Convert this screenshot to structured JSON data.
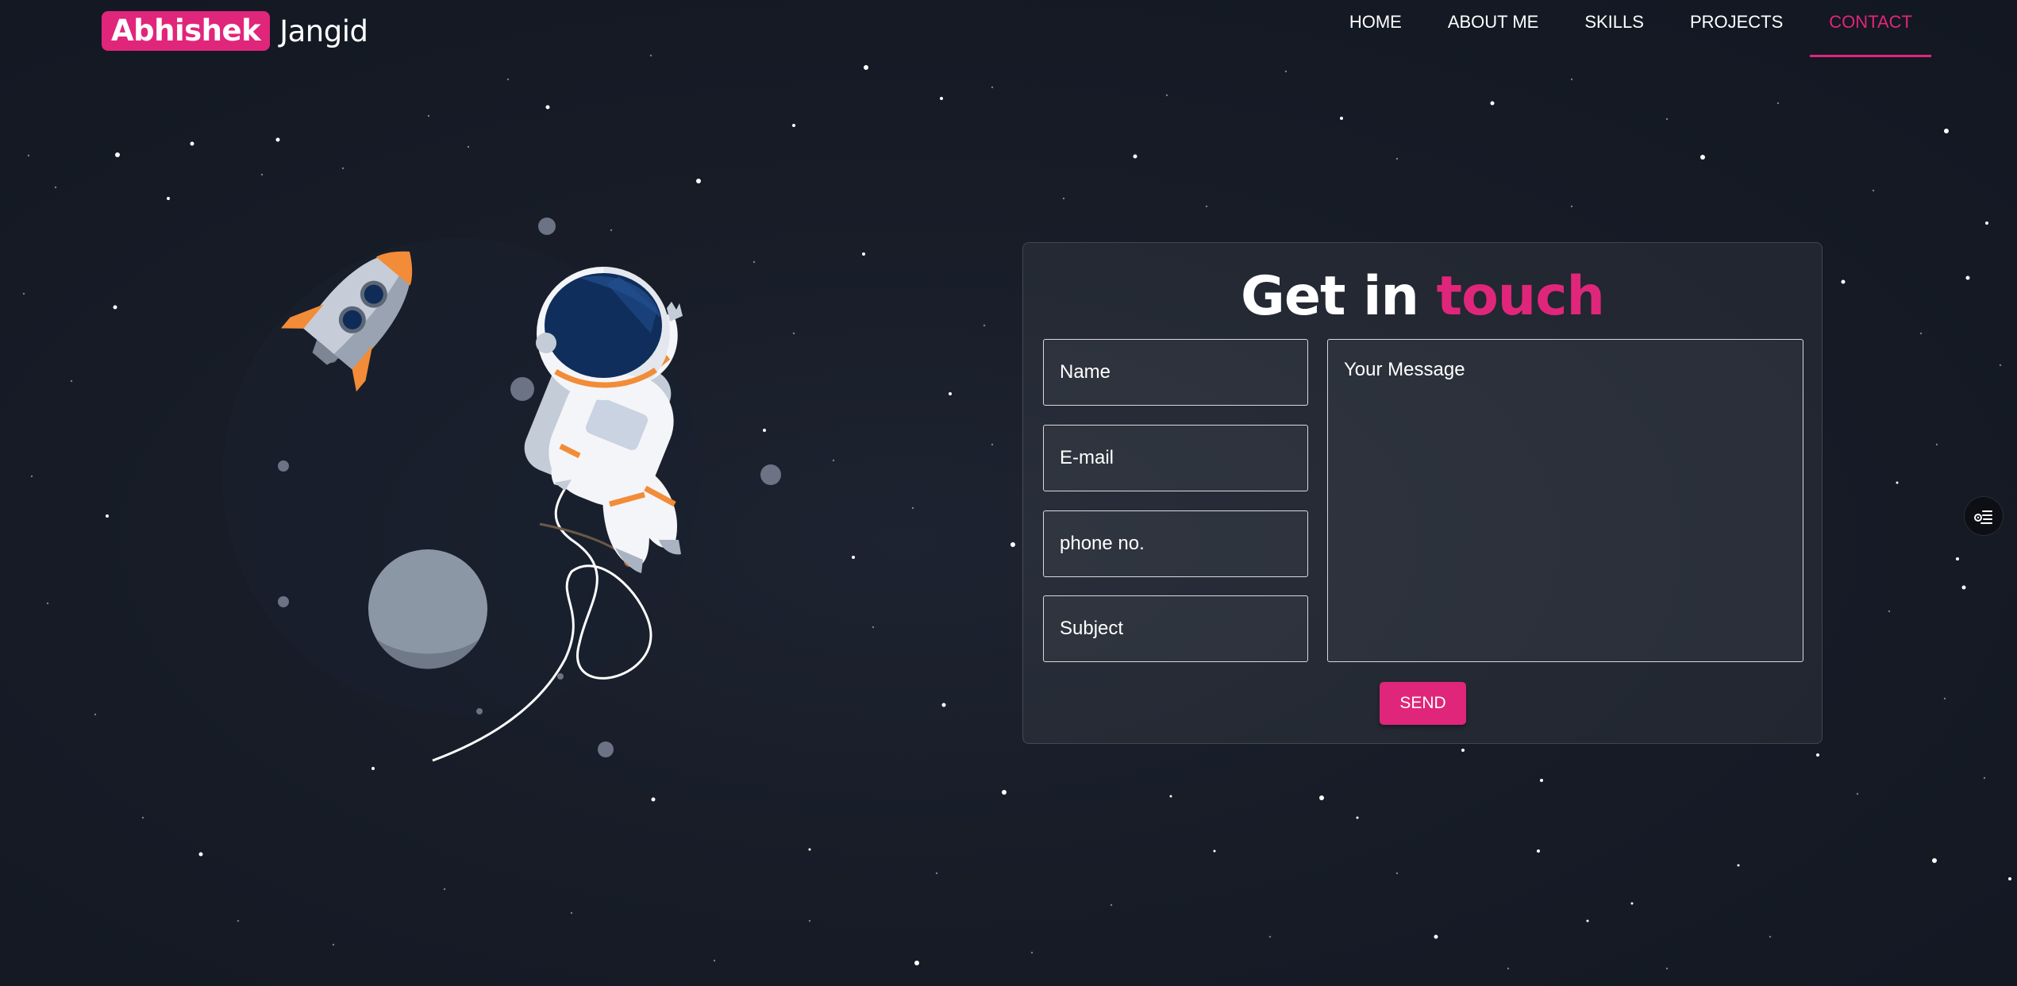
{
  "brand": {
    "first": "Abhishek",
    "last": "Jangid"
  },
  "nav": {
    "items": [
      {
        "label": "HOME"
      },
      {
        "label": "ABOUT ME"
      },
      {
        "label": "SKILLS"
      },
      {
        "label": "PROJECTS"
      },
      {
        "label": "CONTACT",
        "active": true
      }
    ]
  },
  "contact": {
    "title_main": "Get in",
    "title_accent": "touch",
    "name_placeholder": "Name",
    "email_placeholder": "E-mail",
    "phone_placeholder": "phone no.",
    "subject_placeholder": "Subject",
    "message_placeholder": "Your Message",
    "send_label": "SEND"
  },
  "colors": {
    "accent": "#e0267a",
    "background": "#171c27"
  },
  "icons": {
    "side_toggle": "settings-list-icon"
  }
}
